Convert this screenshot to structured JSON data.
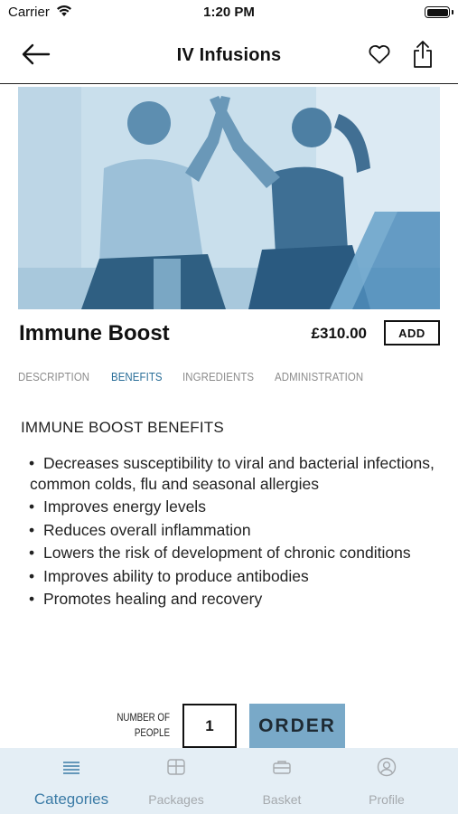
{
  "status_bar": {
    "carrier": "Carrier",
    "time": "1:20 PM"
  },
  "nav": {
    "title": "IV Infusions",
    "back_icon": "arrow-left-icon",
    "favorite_icon": "heart-outline-icon",
    "share_icon": "share-icon"
  },
  "product": {
    "name": "Immune Boost",
    "price": "£310.00",
    "add_label": "ADD"
  },
  "tabs": [
    {
      "label": "DESCRIPTION",
      "active": false
    },
    {
      "label": "BENEFITS",
      "active": true
    },
    {
      "label": "INGREDIENTS",
      "active": false
    },
    {
      "label": "ADMINISTRATION",
      "active": false
    }
  ],
  "content": {
    "title": "IMMUNE BOOST BENEFITS",
    "bullets": [
      "Decreases susceptibility to viral and bacterial infections, common colds, flu and seasonal allergies",
      "Improves energy levels",
      "Reduces overall inflammation",
      "Lowers the risk of development of chronic conditions",
      "Improves ability to produce antibodies",
      "Promotes healing and recovery"
    ]
  },
  "order": {
    "qty_label_line1": "NUMBER OF",
    "qty_label_line2": "PEOPLE",
    "quantity": "1",
    "order_label": "ORDER"
  },
  "tabbar": {
    "items": [
      {
        "label": "Categories",
        "icon": "list-icon",
        "active": true
      },
      {
        "label": "Packages",
        "icon": "package-icon",
        "active": false
      },
      {
        "label": "Basket",
        "icon": "basket-icon",
        "active": false
      },
      {
        "label": "Profile",
        "icon": "profile-icon",
        "active": false
      }
    ]
  },
  "colors": {
    "accent": "#2a6e98",
    "order_button": "#79a9c8",
    "tabbar_bg": "#e4eef5",
    "hero_tint": "#b7d2e3"
  }
}
